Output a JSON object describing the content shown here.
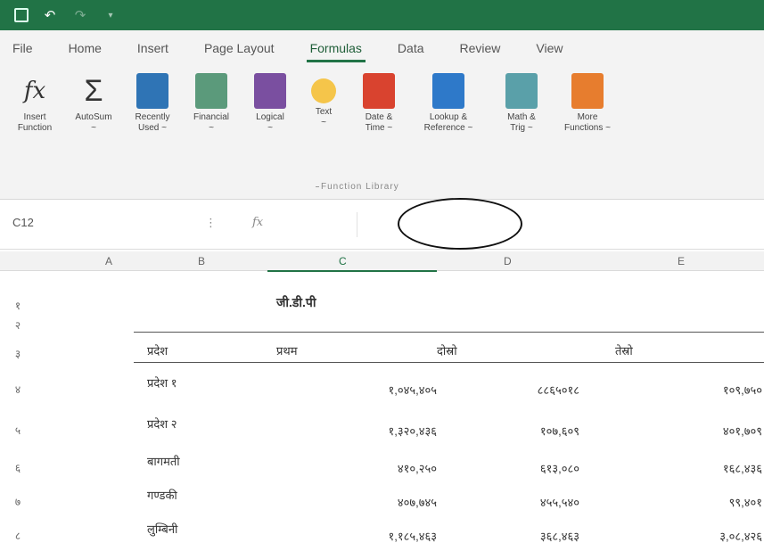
{
  "quick_access": {
    "save_icon": "save-icon",
    "undo_icon": "undo-icon",
    "redo_icon": "redo-icon",
    "customize_icon": "customize-icon"
  },
  "tabs": [
    {
      "label": "File",
      "active": false
    },
    {
      "label": "Home",
      "active": false
    },
    {
      "label": "Insert",
      "active": false
    },
    {
      "label": "Page Layout",
      "active": false
    },
    {
      "label": "Formulas",
      "active": true
    },
    {
      "label": "Data",
      "active": false
    },
    {
      "label": "Review",
      "active": false
    },
    {
      "label": "View",
      "active": false
    }
  ],
  "ribbon": {
    "buttons": [
      {
        "label": "Insert\nFunction",
        "icon": "insert-function-icon",
        "color": "#f3f3f3"
      },
      {
        "label": "AutoSum\n~",
        "icon": "autosum-icon",
        "color": "#f3f3f3"
      },
      {
        "label": "Recently\nUsed ~",
        "icon": "recently-used-icon",
        "color": "#2f74b5"
      },
      {
        "label": "Financial\n~",
        "icon": "financial-icon",
        "color": "#5b9a7b"
      },
      {
        "label": "Logical\n~",
        "icon": "logical-icon",
        "color": "#7a4fa0"
      },
      {
        "label": "Text\n~",
        "icon": "text-icon",
        "color": "#f5c54a"
      },
      {
        "label": "Date &\nTime ~",
        "icon": "date-time-icon",
        "color": "#d9432f"
      },
      {
        "label": "Lookup &\nReference ~",
        "icon": "lookup-reference-icon",
        "color": "#2e79c9"
      },
      {
        "label": "Math &\nTrig ~",
        "icon": "math-trig-icon",
        "color": "#5aa0a9"
      },
      {
        "label": "More\nFunctions ~",
        "icon": "more-functions-icon",
        "color": "#e77d2e"
      }
    ],
    "group_label": "Function Library"
  },
  "formula_bar": {
    "name_box": "C12",
    "fx_label": "fx",
    "value": ""
  },
  "columns": [
    "A",
    "B",
    "C",
    "D",
    "E"
  ],
  "table": {
    "title": "जी.डी.पी",
    "headers": [
      "प्रदेश",
      "प्रथम",
      "दोस्रो",
      "तेस्रो"
    ],
    "rows": [
      {
        "row": "४",
        "name": "प्रदेश १",
        "c": "१,०४५,४०५",
        "d": "८८६५०१८",
        "e": "१०९,७५०"
      },
      {
        "row": "५",
        "name": "प्रदेश २",
        "c": "१,३२०,४३६",
        "d": "१०७,६०९",
        "e": "४०१,७०९"
      },
      {
        "row": "६",
        "name": "बागमती",
        "c": "४१०,२५०",
        "d": "६१३,०८०",
        "e": "१६८,४३६"
      },
      {
        "row": "७",
        "name": "गण्डकी",
        "c": "४०७,७४५",
        "d": "४५५,५४०",
        "e": "९९,४०१"
      },
      {
        "row": "८",
        "name": "लुम्बिनी",
        "c": "१,१८५,४६३",
        "d": "३६८,४६३",
        "e": "३,०८,४२६"
      }
    ],
    "row_numbers_top": [
      "१",
      "२",
      "३"
    ]
  }
}
